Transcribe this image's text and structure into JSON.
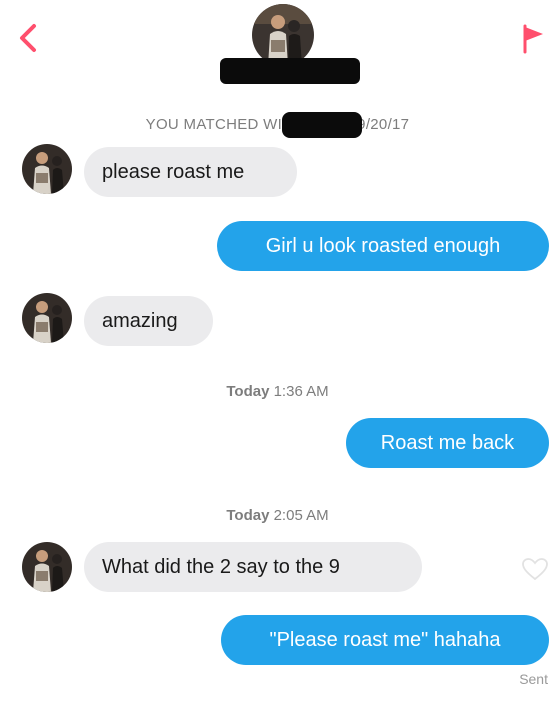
{
  "header": {
    "back_icon": "chevron-left-icon",
    "report_icon": "flag-icon",
    "accent_color": "#ff4f6d"
  },
  "match_info": {
    "prefix": "YOU MATCHED WITH",
    "suffix": "ON 9/20/17"
  },
  "messages": [
    {
      "direction": "incoming",
      "text": "please roast me"
    },
    {
      "direction": "outgoing",
      "text": "Girl u look roasted enough"
    },
    {
      "direction": "incoming",
      "text": "amazing"
    },
    {
      "timestamp_day": "Today",
      "timestamp_time": "1:36 AM"
    },
    {
      "direction": "outgoing",
      "text": "Roast me back"
    },
    {
      "timestamp_day": "Today",
      "timestamp_time": "2:05 AM"
    },
    {
      "direction": "incoming",
      "text": "What did the 2 say to the 9"
    },
    {
      "direction": "outgoing",
      "text": "\"Please roast me\" hahaha"
    }
  ],
  "status": {
    "last_message_status": "Sent",
    "like_icon": "heart-outline-icon"
  },
  "colors": {
    "incoming_bubble": "#ebebed",
    "outgoing_bubble": "#23a3ea",
    "meta_text": "#7d7d7d"
  }
}
